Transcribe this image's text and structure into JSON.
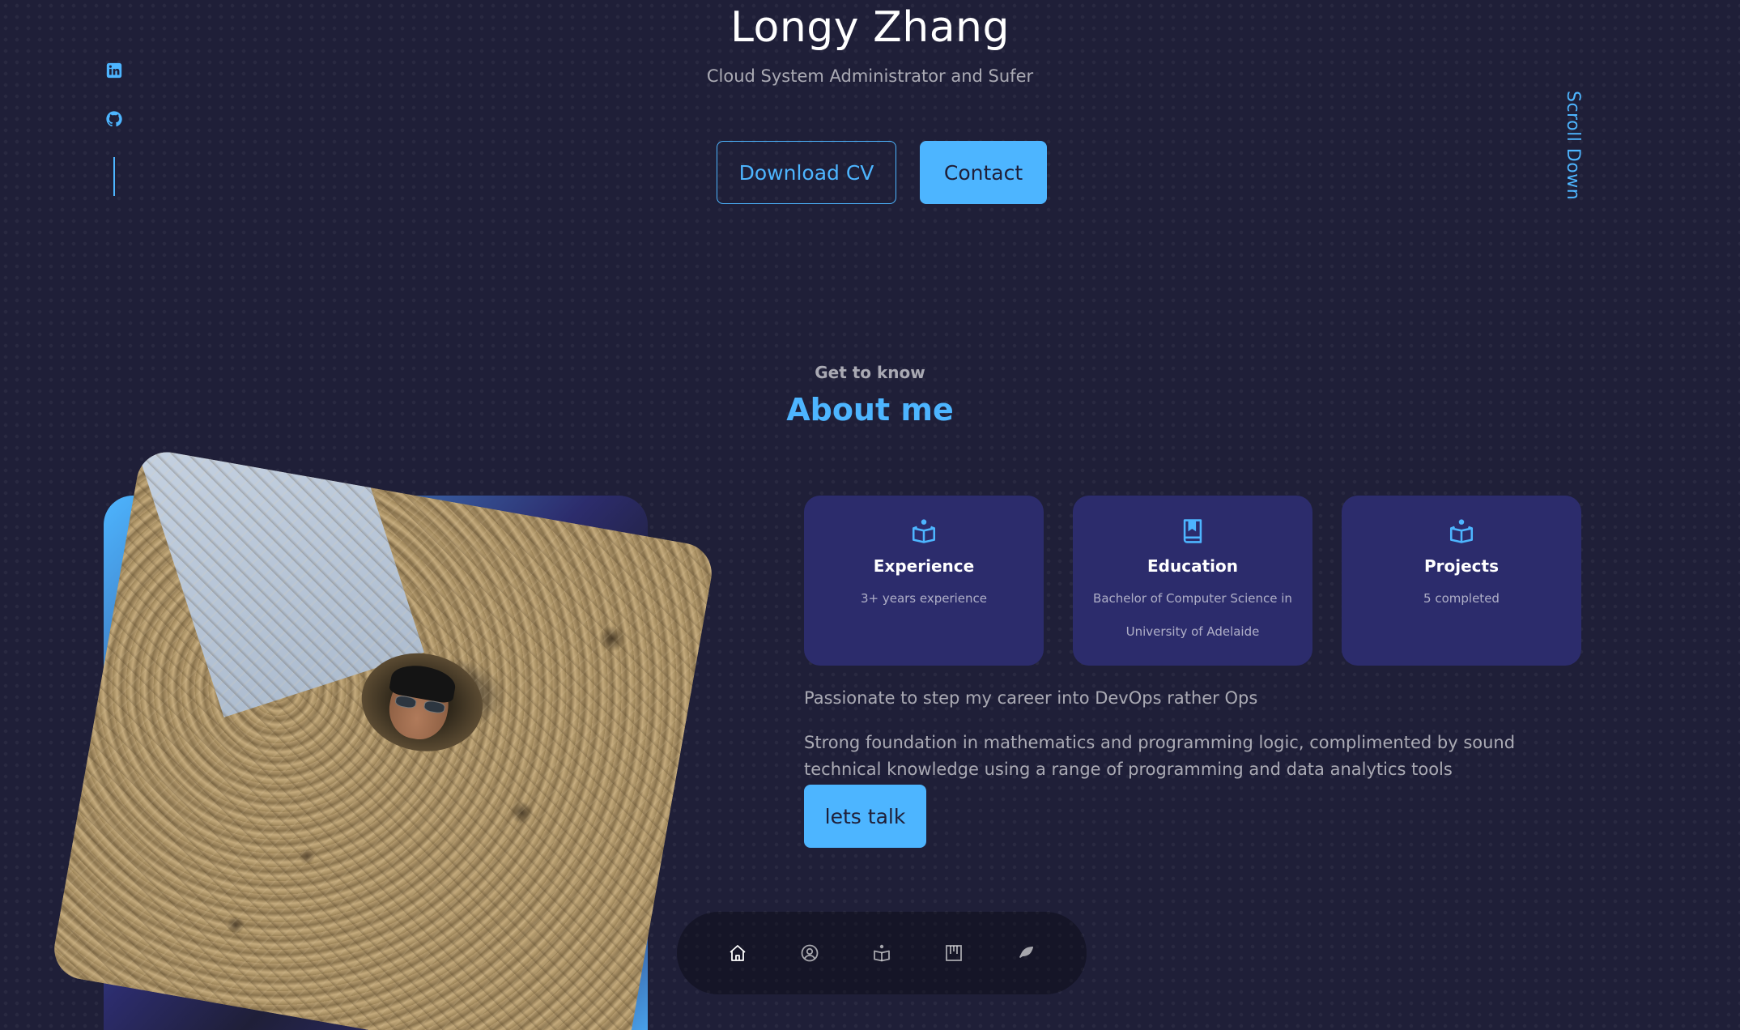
{
  "header": {
    "name": "Longy Zhang",
    "subtitle": "Cloud System Administrator and Sufer",
    "download_cv_label": "Download CV",
    "contact_label": "Contact"
  },
  "socials": [
    {
      "icon": "linkedin-icon"
    },
    {
      "icon": "github-icon"
    }
  ],
  "scroll_down_label": "Scroll Down",
  "about": {
    "kicker": "Get to know",
    "title": "About me",
    "photo_icon": "profile-photo",
    "cards": [
      {
        "icon": "book-reader-icon",
        "title": "Experience",
        "text": "3+ years experience"
      },
      {
        "icon": "book-icon",
        "title": "Education",
        "text": "Bachelor of Computer Science in University of Adelaide"
      },
      {
        "icon": "book-reader-icon",
        "title": "Projects",
        "text": "5 completed"
      }
    ],
    "paragraph_1": "Passionate to step my career into DevOps rather Ops",
    "paragraph_2": "Strong foundation in mathematics and programming logic, complimented by sound technical knowledge using a range of programming and data analytics tools",
    "lets_talk_label": "lets talk"
  },
  "bottom_nav": [
    {
      "icon": "home-icon",
      "active": true
    },
    {
      "icon": "user-icon",
      "active": false
    },
    {
      "icon": "book-reader-icon",
      "active": false
    },
    {
      "icon": "portfolio-icon",
      "active": false
    },
    {
      "icon": "feather-icon",
      "active": false
    }
  ],
  "colors": {
    "background": "#1f1f38",
    "primary": "#4db5ff",
    "card": "#2c2c6c",
    "text": "#ffffff",
    "text_muted": "rgba(255,255,255,0.62)"
  }
}
